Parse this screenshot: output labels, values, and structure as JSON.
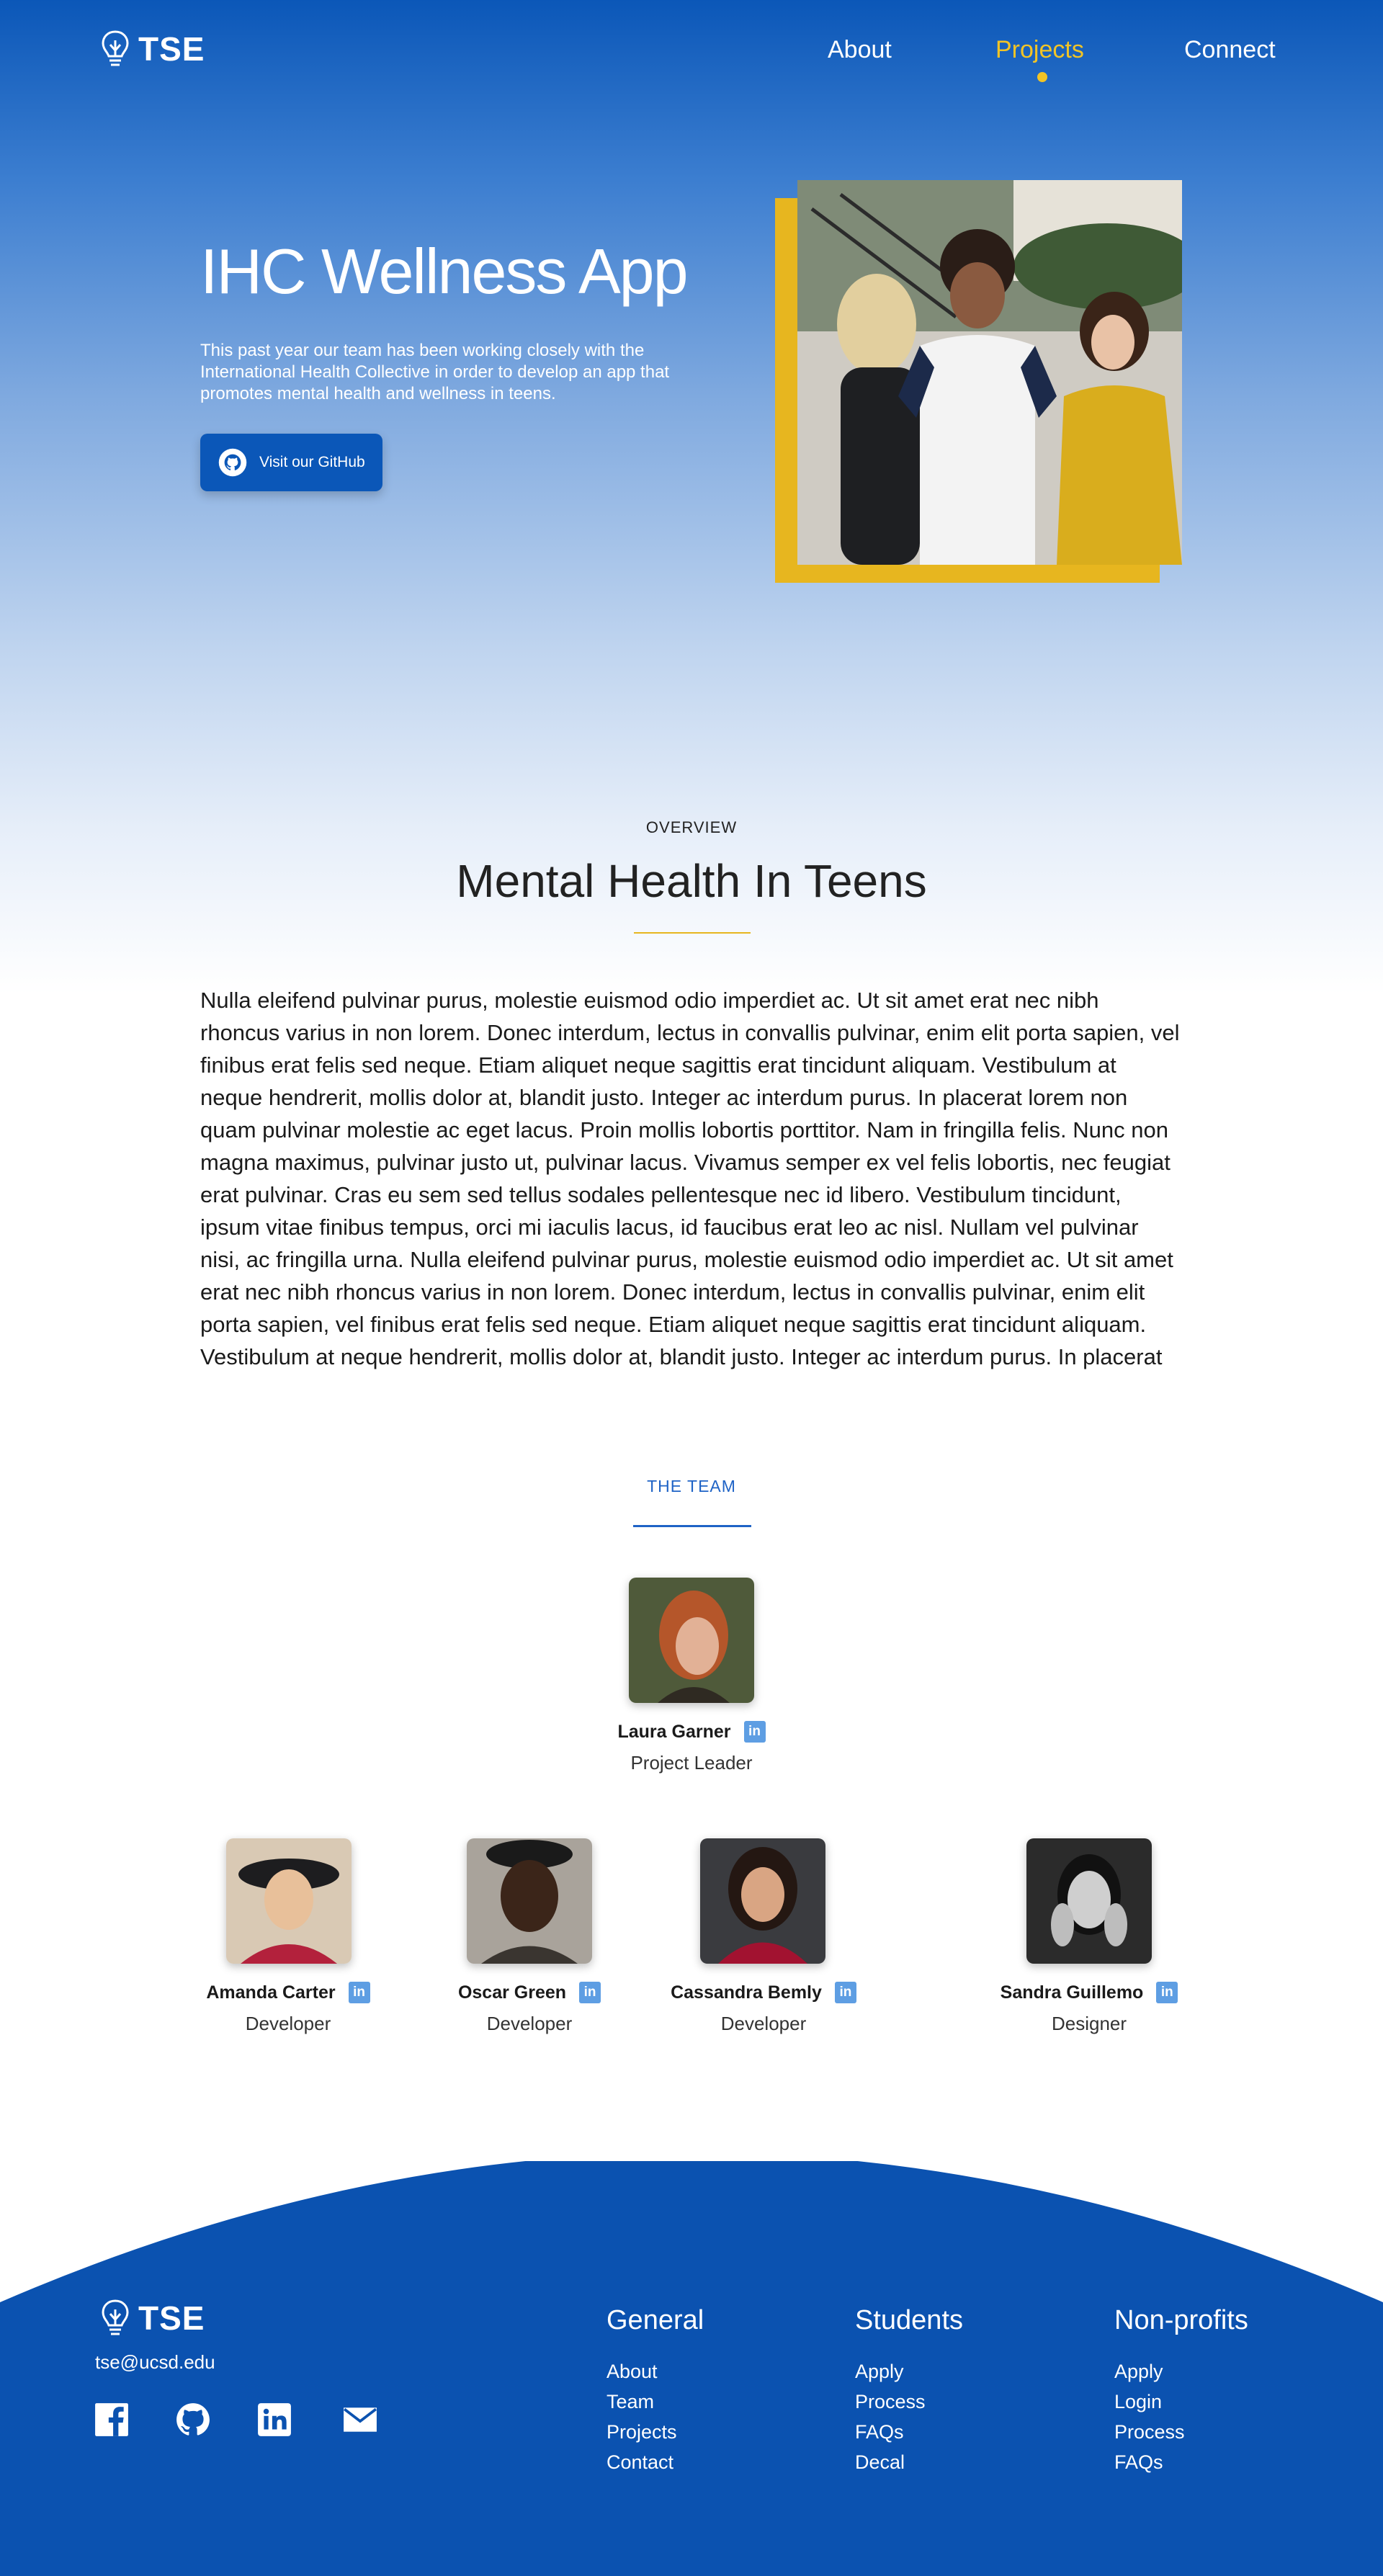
{
  "nav": {
    "brand": "TSE",
    "links": [
      {
        "label": "About"
      },
      {
        "label": "Projects"
      },
      {
        "label": "Connect"
      }
    ]
  },
  "hero": {
    "title": "IHC Wellness App",
    "description": "This past year our team has been working closely with the International Health Collective in order to develop an app that promotes mental health and wellness in teens.",
    "button_label": "Visit our GitHub"
  },
  "overview": {
    "eyebrow": "OVERVIEW",
    "title": "Mental Health In Teens",
    "body": "Nulla eleifend pulvinar purus, molestie euismod odio imperdiet ac. Ut sit amet erat nec nibh rhoncus varius in non lorem. Donec interdum, lectus in convallis pulvinar, enim elit porta sapien, vel finibus erat felis sed neque. Etiam aliquet neque sagittis erat tincidunt aliquam. Vestibulum at neque hendrerit, mollis dolor at, blandit justo. Integer ac interdum purus. In placerat lorem non quam pulvinar molestie ac eget lacus. Proin mollis lobortis porttitor. Nam in fringilla felis. Nunc non magna maximus, pulvinar justo ut, pulvinar lacus. Vivamus semper ex vel felis lobortis, nec feugiat erat pulvinar. Cras eu sem sed tellus sodales pellentesque nec id libero. Vestibulum tincidunt, ipsum vitae finibus tempus, orci mi iaculis lacus, id faucibus erat leo ac nisl. Nullam vel pulvinar nisi, ac fringilla urna. Nulla eleifend pulvinar purus, molestie euismod odio imperdiet ac. Ut sit amet erat nec nibh rhoncus varius in non lorem. Donec interdum, lectus in convallis pulvinar, enim elit porta sapien, vel finibus erat felis sed neque. Etiam aliquet neque sagittis erat tincidunt aliquam. Vestibulum at neque hendrerit, mollis dolor at, blandit justo. Integer ac interdum purus. In placerat"
  },
  "team": {
    "eyebrow": "THE TEAM",
    "leader": {
      "name": "Laura Garner",
      "role": "Project Leader"
    },
    "members": [
      {
        "name": "Amanda Carter",
        "role": "Developer"
      },
      {
        "name": "Oscar Green",
        "role": "Developer"
      },
      {
        "name": "Cassandra Bemly",
        "role": "Developer"
      },
      {
        "name": "Sandra Guillemo",
        "role": "Designer"
      }
    ],
    "linkedin_badge": "in"
  },
  "footer": {
    "brand": "TSE",
    "email": "tse@ucsd.edu",
    "social_icons": [
      "facebook-icon",
      "github-icon",
      "linkedin-icon",
      "mail-icon"
    ],
    "columns": [
      {
        "title": "General",
        "links": [
          "About",
          "Team",
          "Projects",
          "Contact"
        ]
      },
      {
        "title": "Students",
        "links": [
          "Apply",
          "Process",
          "FAQs",
          "Decal"
        ]
      },
      {
        "title": "Non-profits",
        "links": [
          "Apply",
          "Login",
          "Process",
          "FAQs"
        ]
      }
    ]
  },
  "colors": {
    "primary_blue": "#0b57b8",
    "accent_gold": "#f2c425",
    "linkedin_blue": "#5e9ee3"
  }
}
